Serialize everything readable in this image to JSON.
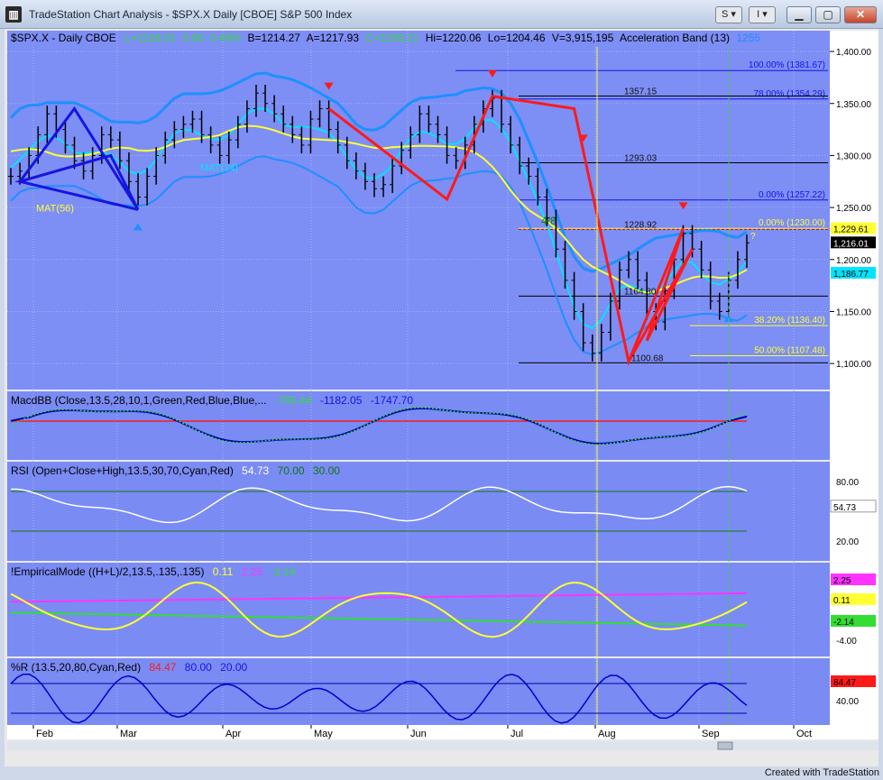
{
  "window": {
    "title": "TradeStation Chart Analysis - $SPX.X Daily [CBOE] S&P 500 Index",
    "app_icon": "chart-app-icon",
    "btn_symbol": "S",
    "btn_indicator": "I",
    "status_text": "Created with TradeStation"
  },
  "colors": {
    "price_bg": "#7d8ef5",
    "panel_bg": "#7a8bf4",
    "axis_bg": "#ffffff",
    "blue_band": "#1e90ff",
    "cyan": "#00e5ff",
    "yellow": "#ffff33",
    "red_pattern": "#ff1a1a",
    "blue_pattern": "#1515e0",
    "magenta": "#ff33ff",
    "green": "#33dd33"
  },
  "chart_data": {
    "type": "line",
    "title": "$SPX.X - Daily  CBOE",
    "header_values": {
      "last": "L=1216.01",
      "change": "5.90",
      "change_pct": "0.49%",
      "bid": "B=1214.27",
      "ask": "A=1217.93",
      "close": "C=1209.21",
      "high": "Hi=1220.06",
      "low": "Lo=1204.46",
      "volume": "V=3,915,195",
      "study": "Acceleration Band (13)",
      "study_value": "1255"
    },
    "x_ticks": [
      "Feb",
      "Mar",
      "Apr",
      "May",
      "Jun",
      "Jul",
      "Aug",
      "Sep",
      "Oct"
    ],
    "price_axis": {
      "ticks": [
        "1,400.00",
        "1,350.00",
        "1,300.00",
        "1,250.00",
        "1,200.00",
        "1,150.00",
        "1,100.00"
      ],
      "ylim": [
        1075,
        1420
      ],
      "tags": [
        {
          "text": "1,229.61",
          "value": 1229.61,
          "color": "#ffff33"
        },
        {
          "text": "1,216.01",
          "value": 1216.01,
          "color": "#000000"
        },
        {
          "text": "1,186.77",
          "value": 1186.77,
          "color": "#00e5ff"
        }
      ]
    },
    "moving_average_labels": [
      {
        "text": "MAT(56)"
      },
      {
        "text": "MAT(14)"
      }
    ],
    "fib_levels": [
      {
        "text": "100.00% (1381.67)",
        "value": 1381.67
      },
      {
        "text": "78.00% (1354.29)",
        "value": 1354.29
      },
      {
        "text": "0.00% (1257.22)",
        "value": 1257.22
      },
      {
        "text": "0.00% (1230.00)",
        "value": 1230.0
      },
      {
        "text": "38.20% (1136.40)",
        "value": 1136.4
      },
      {
        "text": "50.00% (1107.48)",
        "value": 1107.48
      }
    ],
    "price_annotations": [
      {
        "text": "1357.15",
        "value": 1357.15
      },
      {
        "text": "1293.03",
        "value": 1293.03
      },
      {
        "text": "1228.92",
        "value": 1228.92
      },
      {
        "text": "1164.80",
        "value": 1164.8
      },
      {
        "text": "1100.68",
        "value": 1100.68
      },
      {
        "text": "4/8"
      },
      {
        "text": "?"
      }
    ],
    "price_series": [
      1280,
      1285,
      1300,
      1320,
      1340,
      1325,
      1310,
      1295,
      1285,
      1300,
      1320,
      1315,
      1295,
      1275,
      1260,
      1280,
      1300,
      1315,
      1325,
      1330,
      1335,
      1320,
      1310,
      1300,
      1315,
      1330,
      1345,
      1360,
      1350,
      1340,
      1330,
      1320,
      1310,
      1335,
      1345,
      1325,
      1310,
      1295,
      1285,
      1275,
      1268,
      1272,
      1290,
      1305,
      1320,
      1340,
      1330,
      1320,
      1300,
      1295,
      1310,
      1330,
      1345,
      1355,
      1330,
      1310,
      1290,
      1280,
      1260,
      1240,
      1210,
      1180,
      1150,
      1120,
      1110,
      1130,
      1160,
      1190,
      1200,
      1180,
      1150,
      1140,
      1170,
      1200,
      1225,
      1210,
      1190,
      1160,
      1150,
      1180,
      1200,
      1216
    ],
    "macd": {
      "label": "MacdBB (Close,13.5,28,10,1,Green,Red,Blue,Blue,...",
      "values": [
        "-765.44",
        "-1182.05",
        "-1747.70"
      ]
    },
    "rsi": {
      "label": "RSI (Open+Close+High,13.5,30,70,Cyan,Red)",
      "values": [
        "54.73",
        "70.00",
        "30.00"
      ],
      "ticks": [
        "80.00",
        "20.00"
      ],
      "last_tag": "54.73"
    },
    "empirical_mode": {
      "label": "!EmpiricalMode ((H+L)/2,13.5,.135,.135)",
      "values": [
        "0.11",
        "2.25",
        "-2.14"
      ],
      "tags": [
        "2.25",
        "0.11",
        "-2.14"
      ],
      "ticks": [
        "-4.00"
      ]
    },
    "percent_r": {
      "label": "%R (13.5,20,80,Cyan,Red)",
      "values": [
        "84.47",
        "80.00",
        "20.00"
      ],
      "tags": [
        "84.47"
      ],
      "ticks": [
        "40.00"
      ]
    }
  }
}
